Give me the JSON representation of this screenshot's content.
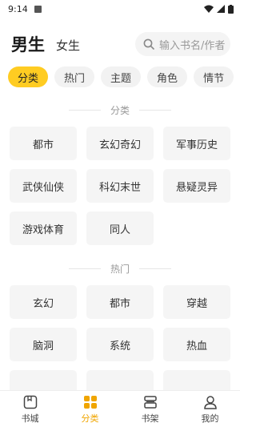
{
  "status_bar": {
    "time": "9:14"
  },
  "header": {
    "gender_male": "男生",
    "gender_female": "女生"
  },
  "search": {
    "placeholder": "输入书名/作者"
  },
  "tabs": [
    {
      "label": "分类",
      "active": true
    },
    {
      "label": "热门",
      "active": false
    },
    {
      "label": "主题",
      "active": false
    },
    {
      "label": "角色",
      "active": false
    },
    {
      "label": "情节",
      "active": false
    }
  ],
  "sections": {
    "category": {
      "title": "分类",
      "items": [
        "都市",
        "玄幻奇幻",
        "军事历史",
        "武侠仙侠",
        "科幻末世",
        "悬疑灵异",
        "游戏体育",
        "同人"
      ]
    },
    "hot": {
      "title": "热门",
      "items": [
        "玄幻",
        "都市",
        "穿越",
        "脑洞",
        "系统",
        "热血"
      ]
    }
  },
  "bottom_nav": [
    {
      "label": "书城",
      "icon": "bookstore-icon",
      "active": false
    },
    {
      "label": "分类",
      "icon": "category-grid-icon",
      "active": true
    },
    {
      "label": "书架",
      "icon": "bookshelf-icon",
      "active": false
    },
    {
      "label": "我的",
      "icon": "profile-icon",
      "active": false
    }
  ],
  "colors": {
    "accent": "#ffcc22",
    "accent_text": "#f0a500",
    "chip_bg": "#f5f5f5"
  }
}
